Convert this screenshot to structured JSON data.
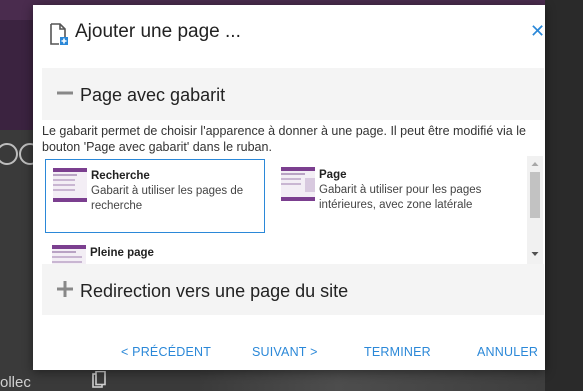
{
  "background": {
    "partial_text": "ollec"
  },
  "dialog": {
    "title": "Ajouter une page ...",
    "close_icon": "close-icon",
    "section_template": {
      "label": "Page avec gabarit",
      "icon": "minus-icon"
    },
    "description": "Le gabarit permet de choisir l'apparence à donner à une page. Il peut être modifié via le bouton 'Page avec gabarit' dans le ruban.",
    "templates": [
      {
        "name": "Recherche",
        "description": "Gabarit à utiliser les pages de recherche",
        "selected": true
      },
      {
        "name": "Page",
        "description": "Gabarit à utiliser pour les pages intérieures, avec zone latérale",
        "selected": false
      },
      {
        "name": "Pleine page",
        "description": "",
        "selected": false
      }
    ],
    "section_redirect": {
      "label": "Redirection vers une page du site",
      "icon": "plus-icon"
    },
    "buttons": {
      "previous": "< PRÉCÉDENT",
      "next": "SUIVANT >",
      "finish": "TERMINER",
      "cancel": "ANNULER"
    },
    "colors": {
      "accent": "#2b88d8",
      "section_bg": "#f4f4f4",
      "thumb_purple": "#7b3f8f"
    }
  }
}
